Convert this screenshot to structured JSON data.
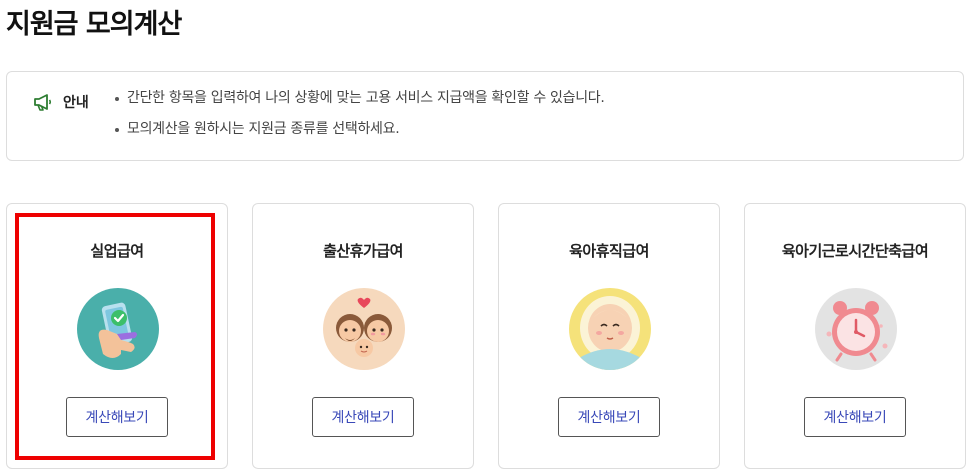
{
  "page": {
    "title": "지원금 모의계산"
  },
  "notice": {
    "label": "안내",
    "icon": "megaphone-icon",
    "items": [
      "간단한 항목을 입력하여 나의 상황에 맞는 고용 서비스 지급액을 확인할 수 있습니다.",
      "모의계산을 원하시는 지원금 종류를 선택하세요."
    ]
  },
  "cards": [
    {
      "title": "실업급여",
      "icon": "phone-check-illustration",
      "button": "계산해보기",
      "circle": "#4aafaa"
    },
    {
      "title": "출산휴가급여",
      "icon": "parents-baby-illustration",
      "button": "계산해보기",
      "circle": "#f6d9bd"
    },
    {
      "title": "육아휴직급여",
      "icon": "baby-face-illustration",
      "button": "계산해보기",
      "circle": "#f5e27a"
    },
    {
      "title": "육아기근로시간단축급여",
      "icon": "alarm-clock-illustration",
      "button": "계산해보기",
      "circle": "#e3e3e3"
    }
  ],
  "colors": {
    "accent_text": "#3a49b8",
    "highlight": "#ee0000",
    "notice_icon": "#2e7d32"
  }
}
